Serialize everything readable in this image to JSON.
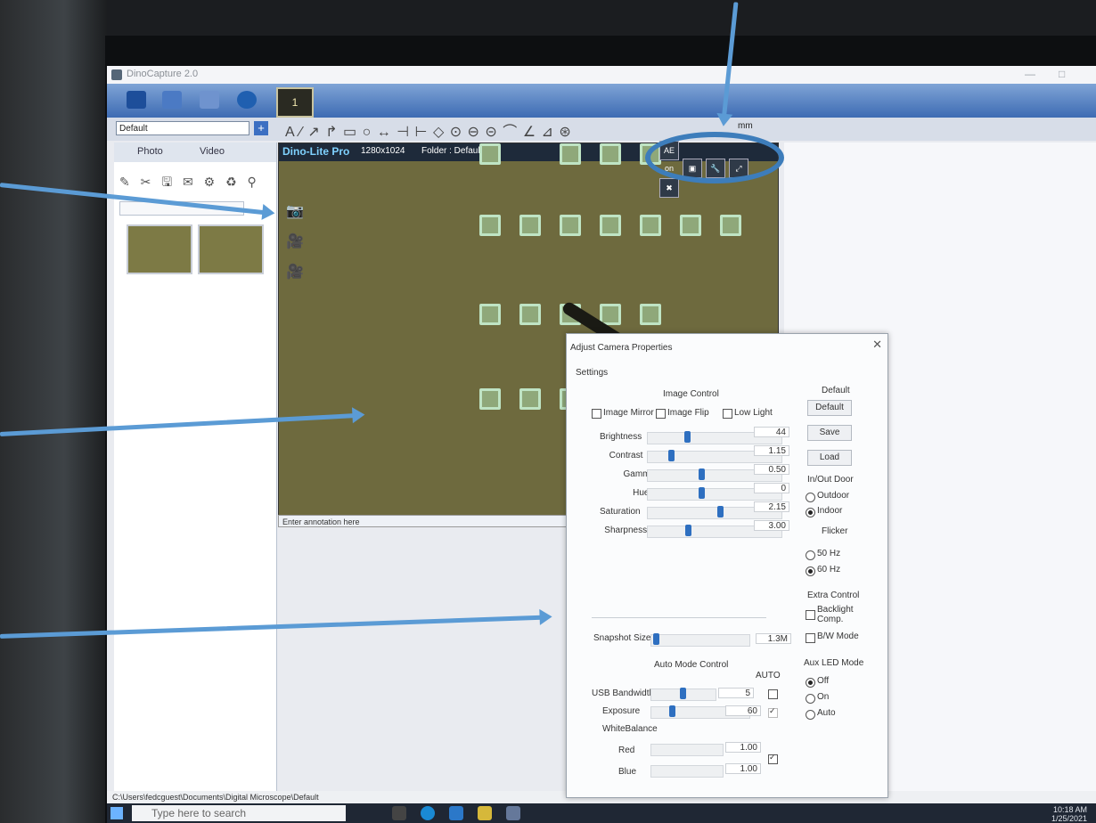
{
  "window": {
    "title": "DinoCapture 2.0",
    "minimize": "—",
    "maximize": "□"
  },
  "toolbar": {
    "live_button": "1",
    "profile_select": "Default",
    "unit_select": "mm",
    "annotation_tools": "A ⁄ ↗ ↱ ▭ ○ ↔ ⊣ ⊢ ◇ ⊙ ⊖ ⊝ ⌒ ∠ ⊿ ⊛"
  },
  "left_panel": {
    "tabs": [
      {
        "label": "Photo"
      },
      {
        "label": "Video"
      }
    ],
    "icon_row": "✎ ✂ 🖫 ✉ ⚙ ♻ ⚲"
  },
  "view": {
    "brand": "Dino-Lite Pro",
    "resolution": "1280x1024",
    "folder": "Folder : Default",
    "annotation_placeholder": "Enter annotation here",
    "tool_ae": "AE on"
  },
  "status_bar": {
    "path": "C:\\Users\\fedcguest\\Documents\\Digital Microscope\\Default"
  },
  "taskbar": {
    "search_placeholder": "Type here to search",
    "time": "10:18 AM",
    "date": "1/25/2021"
  },
  "dialog": {
    "title": "Adjust Camera Properties",
    "settings_label": "Settings",
    "image_control": {
      "heading": "Image Control",
      "image_mirror": "Image Mirror",
      "image_flip": "Image Flip",
      "low_light": "Low Light"
    },
    "sliders": [
      {
        "label": "Brightness",
        "value": "44",
        "pos": 0.27
      },
      {
        "label": "Contrast",
        "value": "1.15",
        "pos": 0.15
      },
      {
        "label": "Gamma",
        "value": "0.50",
        "pos": 0.38
      },
      {
        "label": "Hue",
        "value": "0",
        "pos": 0.38
      },
      {
        "label": "Saturation",
        "value": "2.15",
        "pos": 0.52
      },
      {
        "label": "Sharpness",
        "value": "3.00",
        "pos": 0.28
      }
    ],
    "snapshot": {
      "label": "Snapshot Size",
      "value": "1.3M",
      "pos": 0.02
    },
    "auto_mode": {
      "heading": "Auto Mode Control",
      "auto_label": "AUTO",
      "usb_bandwidth": {
        "label": "USB Bandwidth",
        "value": "5",
        "pos": 0.45
      },
      "exposure": {
        "label": "Exposure",
        "value": "60",
        "pos": 0.18
      },
      "white_balance": "WhiteBalance",
      "red": {
        "label": "Red",
        "value": "1.00"
      },
      "blue": {
        "label": "Blue",
        "value": "1.00"
      }
    },
    "default_group": {
      "heading": "Default",
      "default": "Default",
      "save": "Save",
      "load": "Load"
    },
    "in_out_door": {
      "heading": "In/Out Door",
      "outdoor": "Outdoor",
      "indoor": "Indoor"
    },
    "flicker": {
      "heading": "Flicker",
      "hz50": "50 Hz",
      "hz60": "60 Hz"
    },
    "extra_control": {
      "heading": "Extra Control",
      "backlight": "Backlight Comp.",
      "bw_mode": "B/W Mode"
    },
    "aux_led": {
      "heading": "Aux LED Mode",
      "off": "Off",
      "on": "On",
      "auto": "Auto"
    }
  },
  "colors": {
    "accent_blue": "#2e6fc0",
    "callout": "#5b9bd5",
    "brand_cyan": "#7fd2ff"
  }
}
